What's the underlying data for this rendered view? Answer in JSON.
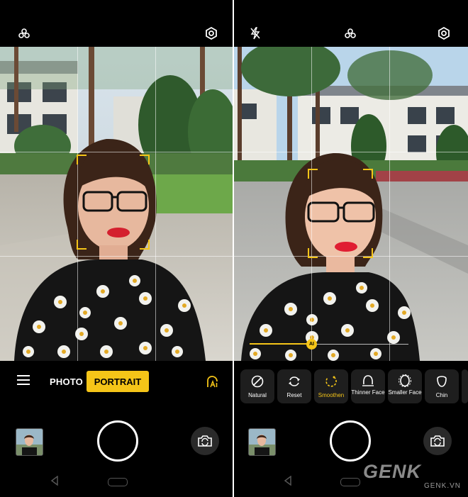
{
  "left_panel": {
    "top_icons": [
      "filter-icon",
      "settings-icon"
    ],
    "modes": {
      "photo_label": "PHOTO",
      "portrait_label": "PORTRAIT"
    },
    "icons": {
      "menu": "menu-icon",
      "ai_beauty": "ai-beauty-icon",
      "switch_camera": "switch-camera-icon"
    }
  },
  "right_panel": {
    "top_icons": [
      "flash-off-icon",
      "filter-icon",
      "settings-icon"
    ],
    "slider_badge": "AI",
    "beauty_options": [
      {
        "label": "Natural",
        "icon": "natural-icon",
        "active": false
      },
      {
        "label": "Reset",
        "icon": "reset-icon",
        "active": false
      },
      {
        "label": "Smoothen",
        "icon": "smoothen-icon",
        "active": true
      },
      {
        "label": "Thinner Face",
        "icon": "thinner-face-icon",
        "active": false
      },
      {
        "label": "Smaller Face",
        "icon": "smaller-face-icon",
        "active": false
      },
      {
        "label": "Chin",
        "icon": "chin-icon",
        "active": false
      }
    ]
  },
  "watermark": {
    "brand": "GENK",
    "site": "GENK.VN"
  },
  "colors": {
    "accent": "#f5c518",
    "background": "#000000",
    "chip": "#1e1e1e"
  }
}
